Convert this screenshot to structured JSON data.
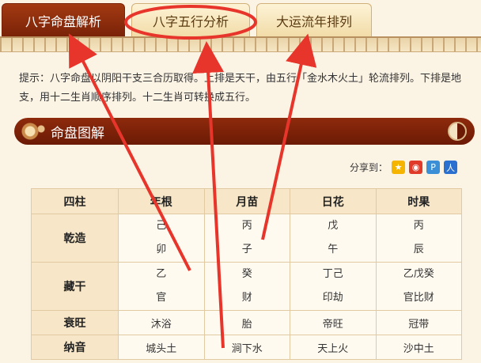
{
  "tabs": [
    {
      "label": "八字命盘解析",
      "active": true
    },
    {
      "label": "八字五行分析",
      "active": false
    },
    {
      "label": "大运流年排列",
      "active": false
    }
  ],
  "notice": "提示：八字命盘以阴阳干支三合历取得。上排是天干，由五行「金水木火土」轮流排列。下排是地支，用十二生肖顺序排列。十二生肖可转换成五行。",
  "section": {
    "title": "命盘图解"
  },
  "share": {
    "label": "分享到：",
    "icons": [
      "qzone-icon",
      "weibo-icon",
      "tencent-icon",
      "renren-icon"
    ]
  },
  "table": {
    "headers": [
      "四柱",
      "年根",
      "月苗",
      "日花",
      "时果"
    ],
    "qianzao": {
      "label": "乾造",
      "top": [
        "己",
        "丙",
        "戊",
        "丙"
      ],
      "bottom": [
        "卯",
        "子",
        "午",
        "辰"
      ]
    },
    "canggan": {
      "label": "藏干",
      "top": [
        "乙",
        "癸",
        "丁己",
        "乙戊癸"
      ],
      "bottom": [
        "官",
        "财",
        "印劫",
        "官比财"
      ]
    },
    "shuaiwang": {
      "label": "衰旺",
      "values": [
        "沐浴",
        "胎",
        "帝旺",
        "冠带"
      ]
    },
    "nayin": {
      "label": "纳音",
      "values": [
        "城头土",
        "涧下水",
        "天上火",
        "沙中土"
      ]
    }
  },
  "colors": {
    "accent": "#7a2208",
    "annotation": "#e8352b"
  }
}
